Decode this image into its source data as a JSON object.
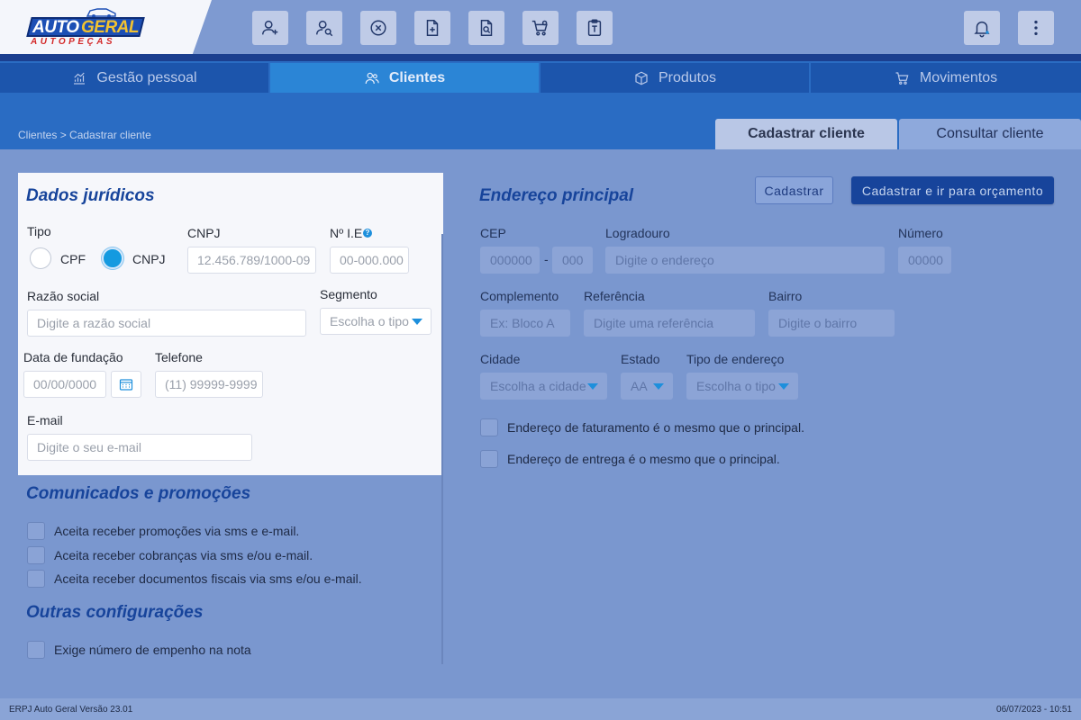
{
  "brand": {
    "word1": "AUTO",
    "word2": "GERAL",
    "sub": "AUTOPEÇAS"
  },
  "toolbar": {
    "buttons": [
      {
        "name": "add-user-icon"
      },
      {
        "name": "search-user-icon"
      },
      {
        "name": "cancel-circle-icon"
      },
      {
        "name": "new-document-icon"
      },
      {
        "name": "search-document-icon"
      },
      {
        "name": "cart-settings-icon"
      },
      {
        "name": "clipboard-text-icon"
      }
    ],
    "right": [
      {
        "name": "bell-icon"
      },
      {
        "name": "more-vertical-icon"
      }
    ]
  },
  "nav": {
    "tabs": [
      {
        "label": "Gestão pessoal",
        "icon": "chart-icon"
      },
      {
        "label": "Clientes",
        "icon": "users-icon"
      },
      {
        "label": "Produtos",
        "icon": "box-icon"
      },
      {
        "label": "Movimentos",
        "icon": "cart-icon"
      }
    ],
    "active": "Clientes"
  },
  "breadcrumb": "Clientes > Cadastrar cliente",
  "subtabs": [
    {
      "label": "Cadastrar cliente"
    },
    {
      "label": "Consultar cliente"
    }
  ],
  "juridico": {
    "title": "Dados jurídicos",
    "tipo_label": "Tipo",
    "radio_cpf": "CPF",
    "radio_cnpj": "CNPJ",
    "cnpj_label": "CNPJ",
    "cnpj_placeholder": "12.456.789/1000-09",
    "ie_label": "Nº I.E",
    "ie_help": "?",
    "ie_placeholder": "00-000.000",
    "razao_label": "Razão social",
    "razao_placeholder": "Digite a razão social",
    "segmento_label": "Segmento",
    "segmento_value": "Escolha o tipo",
    "fundacao_label": "Data de fundação",
    "fundacao_placeholder": "00/00/0000",
    "telefone_label": "Telefone",
    "telefone_placeholder": "(11) 99999-9999",
    "email_label": "E-mail",
    "email_placeholder": "Digite o seu e-mail"
  },
  "comunicados": {
    "title": "Comunicados e promoções",
    "options": [
      "Aceita receber promoções via sms e e-mail.",
      "Aceita receber cobranças via sms e/ou e-mail.",
      "Aceita receber documentos fiscais via sms e/ou e-mail."
    ]
  },
  "outras": {
    "title": "Outras configurações",
    "options": [
      "Exige número de empenho na nota"
    ]
  },
  "endereco": {
    "title": "Endereço principal",
    "btn_cadastrar": "Cadastrar",
    "btn_cadastrar_orcamento": "Cadastrar e ir para orçamento",
    "cep_label": "CEP",
    "cep_placeholder_1": "000000",
    "cep_sep": "-",
    "cep_placeholder_2": "000",
    "logradouro_label": "Logradouro",
    "logradouro_placeholder": "Digite o endereço",
    "numero_label": "Número",
    "numero_placeholder": "00000",
    "complemento_label": "Complemento",
    "complemento_placeholder": "Ex: Bloco A",
    "referencia_label": "Referência",
    "referencia_placeholder": "Digite uma referência",
    "bairro_label": "Bairro",
    "bairro_placeholder": "Digite o bairro",
    "cidade_label": "Cidade",
    "cidade_value": "Escolha a cidade",
    "estado_label": "Estado",
    "estado_value": "AA",
    "tipo_label": "Tipo de endereço",
    "tipo_value": "Escolha o tipo",
    "options": [
      "Endereço de faturamento é o mesmo que o principal.",
      "Endereço de entrega é o mesmo que o principal."
    ]
  },
  "footer": {
    "version": "ERPJ Auto Geral Versão 23.01",
    "datetime": "06/07/2023 - 10:51"
  },
  "colors": {
    "primary": "#17449b",
    "accent": "#1d8fdc",
    "nav": "#2a6cc3",
    "overlay": "#7a97cf"
  }
}
